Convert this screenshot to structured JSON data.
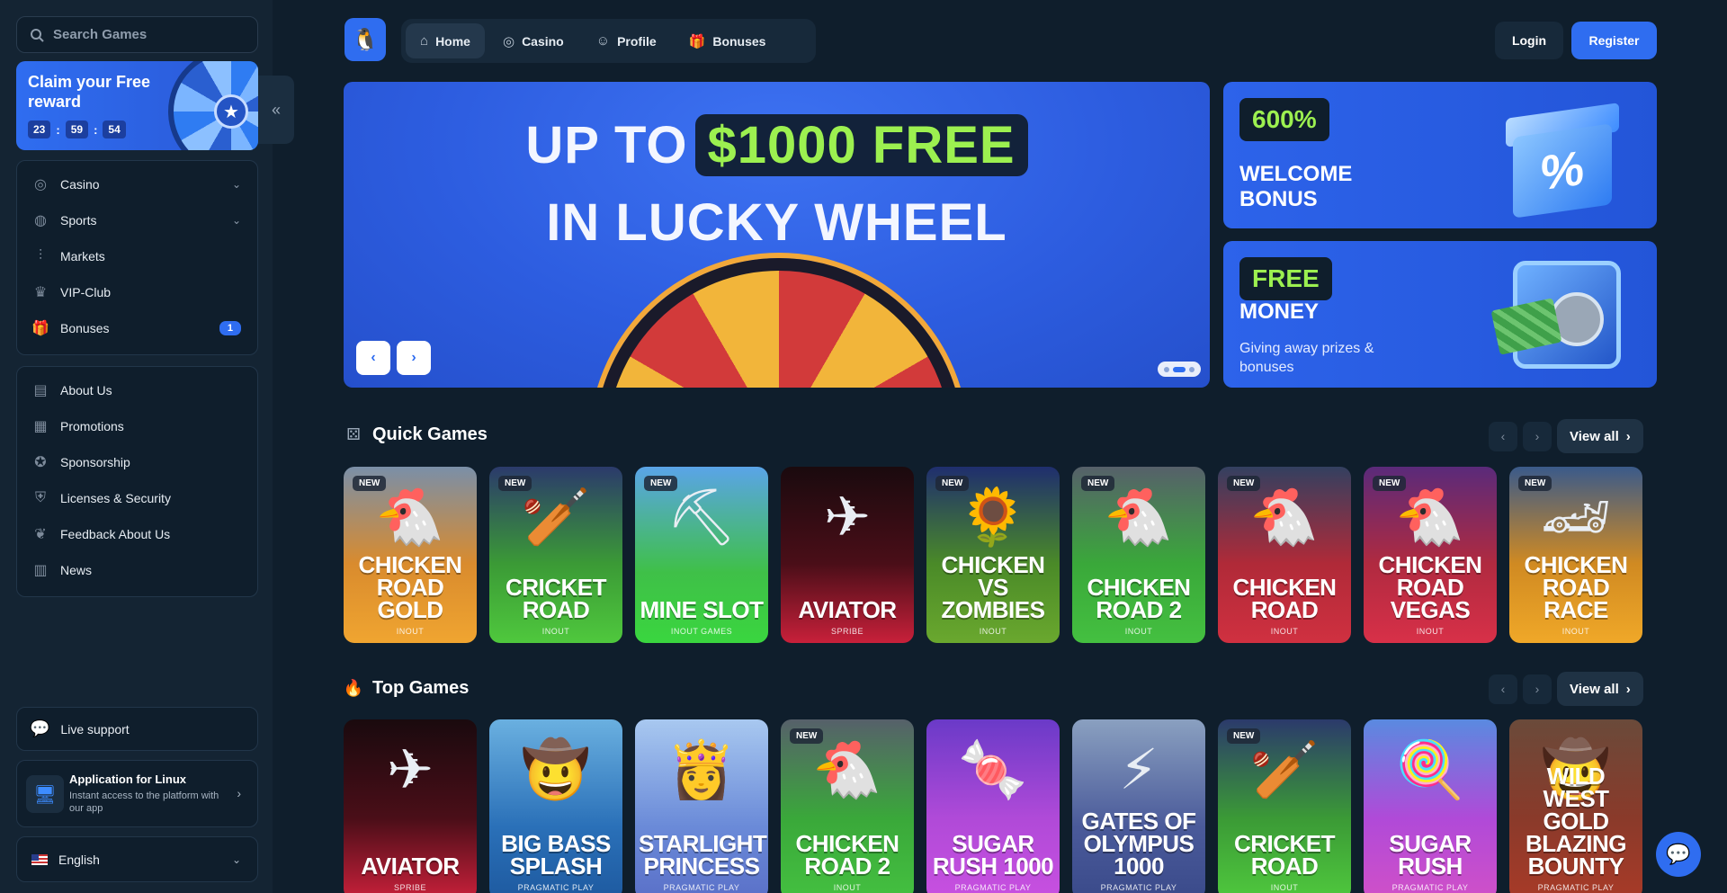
{
  "sidebar": {
    "search_placeholder": "Search Games",
    "reward": {
      "title": "Claim your Free reward",
      "timer": [
        "23",
        "59",
        "54"
      ]
    },
    "nav_primary": [
      {
        "label": "Casino",
        "icon": "casino-chip-icon",
        "expandable": true
      },
      {
        "label": "Sports",
        "icon": "globe-icon",
        "expandable": true
      },
      {
        "label": "Markets",
        "icon": "candles-icon",
        "expandable": false
      },
      {
        "label": "VIP-Club",
        "icon": "crown-icon",
        "expandable": false
      },
      {
        "label": "Bonuses",
        "icon": "gift-icon",
        "badge": "1"
      }
    ],
    "nav_secondary": [
      {
        "label": "About Us",
        "icon": "book-icon"
      },
      {
        "label": "Promotions",
        "icon": "ticket-icon"
      },
      {
        "label": "Sponsorship",
        "icon": "medal-icon"
      },
      {
        "label": "Licenses & Security",
        "icon": "shield-icon"
      },
      {
        "label": "Feedback About Us",
        "icon": "chat-heart-icon"
      },
      {
        "label": "News",
        "icon": "newspaper-icon"
      }
    ],
    "live_support": "Live support",
    "app": {
      "title": "Application for Linux",
      "desc": "Instant access to the platform with our app"
    },
    "language": "English"
  },
  "topbar": {
    "tabs": [
      {
        "label": "Home",
        "icon": "home-icon",
        "active": true
      },
      {
        "label": "Casino",
        "icon": "casino-chip-icon",
        "active": false
      },
      {
        "label": "Profile",
        "icon": "user-icon",
        "active": false
      },
      {
        "label": "Bonuses",
        "icon": "gift-icon",
        "active": false
      }
    ],
    "login": "Login",
    "register": "Register"
  },
  "hero": {
    "line1_pre": "UP TO",
    "line1_highlight": "$1000 FREE",
    "line2": "IN LUCKY WHEEL",
    "slide_count": 3,
    "active_slide": 2
  },
  "promos": [
    {
      "pill": "600%",
      "title": "WELCOME BONUS"
    },
    {
      "pill": "FREE",
      "title": "MONEY",
      "desc": "Giving away prizes & bonuses"
    }
  ],
  "colors": {
    "background": "#0f1e2c",
    "sidebar": "#142433",
    "accent": "#2f6df0",
    "highlight_green": "#9cf050"
  },
  "quick_games": {
    "title": "Quick Games",
    "view_all": "View all",
    "items": [
      {
        "name": "CHICKEN ROAD GOLD",
        "provider": "INOUT",
        "new": true,
        "bg": "linear-gradient(180deg,#7a8fa8 0%,#d98b2e 55%,#f0a530 100%)",
        "art": "🐔"
      },
      {
        "name": "CRICKET ROAD",
        "provider": "INOUT",
        "new": true,
        "bg": "linear-gradient(180deg,#2b3a6b 0%,#3b9a36 55%,#4fc83d 100%)",
        "art": "🏏"
      },
      {
        "name": "MINE SLOT",
        "provider": "INOUT GAMES",
        "new": true,
        "bg": "linear-gradient(180deg,#5aa4e8 0%,#3fc048 60%,#3ad63f 100%)",
        "art": "⛏"
      },
      {
        "name": "AVIATOR",
        "provider": "SPRIBE",
        "new": false,
        "bg": "linear-gradient(180deg,#1a0a0e 0%,#4a0e18 55%,#c8203a 100%)",
        "art": "✈"
      },
      {
        "name": "CHICKEN VS ZOMBIES",
        "provider": "INOUT",
        "new": true,
        "bg": "linear-gradient(180deg,#1f2e6e 0%,#4a8a28 55%,#6aa82e 100%)",
        "art": "🌻"
      },
      {
        "name": "CHICKEN ROAD 2",
        "provider": "INOUT",
        "new": true,
        "bg": "linear-gradient(180deg,#56606a 0%,#3aa83a 55%,#44c040 100%)",
        "art": "🐔"
      },
      {
        "name": "CHICKEN ROAD",
        "provider": "INOUT",
        "new": true,
        "bg": "linear-gradient(180deg,#334060 0%,#b02a38 55%,#d03040 100%)",
        "art": "🐔"
      },
      {
        "name": "CHICKEN ROAD VEGAS",
        "provider": "INOUT",
        "new": true,
        "bg": "linear-gradient(180deg,#5a2a7a 0%,#b02a40 55%,#d83048 100%)",
        "art": "🐔"
      },
      {
        "name": "CHICKEN ROAD RACE",
        "provider": "INOUT",
        "new": true,
        "bg": "linear-gradient(180deg,#3a5a8a 0%,#d08a22 55%,#f0a828 100%)",
        "art": "🏎"
      }
    ]
  },
  "top_games": {
    "title": "Top Games",
    "view_all": "View all",
    "items": [
      {
        "name": "AVIATOR",
        "provider": "SPRIBE",
        "new": false,
        "bg": "linear-gradient(180deg,#1a0a0e 0%,#4a0e18 55%,#c8203a 100%)",
        "art": "✈"
      },
      {
        "name": "BIG BASS SPLASH",
        "provider": "PRAGMATIC PLAY",
        "new": false,
        "bg": "linear-gradient(180deg,#6ab0e0 0%,#2a70b8 60%,#1e5aa0 100%)",
        "art": "🤠"
      },
      {
        "name": "STARLIGHT PRINCESS",
        "provider": "PRAGMATIC PLAY",
        "new": false,
        "bg": "linear-gradient(180deg,#a8c8f0 0%,#6a8ad8 60%,#5a70c8 100%)",
        "art": "👸"
      },
      {
        "name": "CHICKEN ROAD 2",
        "provider": "INOUT",
        "new": true,
        "bg": "linear-gradient(180deg,#56606a 0%,#3aa83a 55%,#44c040 100%)",
        "art": "🐔"
      },
      {
        "name": "SUGAR RUSH 1000",
        "provider": "PRAGMATIC PLAY",
        "new": false,
        "bg": "linear-gradient(180deg,#6a3ac8 0%,#b04ad8 55%,#c850e0 100%)",
        "art": "🍬"
      },
      {
        "name": "GATES OF OLYMPUS 1000",
        "provider": "PRAGMATIC PLAY",
        "new": false,
        "bg": "linear-gradient(180deg,#8aa0c0 0%,#4a5a9a 60%,#3a4a8a 100%)",
        "art": "⚡"
      },
      {
        "name": "CRICKET ROAD",
        "provider": "INOUT",
        "new": true,
        "bg": "linear-gradient(180deg,#2b3a6b 0%,#3b9a36 55%,#4fc83d 100%)",
        "art": "🏏"
      },
      {
        "name": "SUGAR RUSH",
        "provider": "PRAGMATIC PLAY",
        "new": false,
        "bg": "linear-gradient(180deg,#5a8ae0 0%,#b04ad8 55%,#d050c8 100%)",
        "art": "🍭"
      },
      {
        "name": "WILD WEST GOLD BLAZING BOUNTY",
        "provider": "PRAGMATIC PLAY",
        "new": false,
        "bg": "linear-gradient(180deg,#6a4a3a 0%,#8a3a2a 55%,#a83a28 100%)",
        "art": "🤠"
      }
    ]
  }
}
